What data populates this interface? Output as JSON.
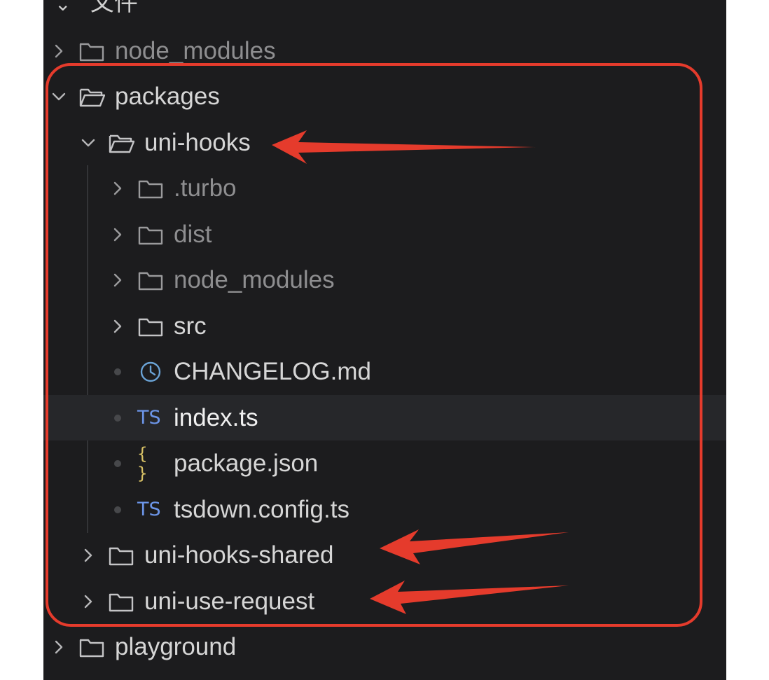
{
  "explorer": {
    "header_label": "文件",
    "items": [
      {
        "label": "node_modules"
      },
      {
        "label": "packages"
      },
      {
        "label": "uni-hooks"
      },
      {
        "label": ".turbo"
      },
      {
        "label": "dist"
      },
      {
        "label": "node_modules"
      },
      {
        "label": "src"
      },
      {
        "label": "CHANGELOG.md"
      },
      {
        "label": "index.ts",
        "icon_text": "TS"
      },
      {
        "label": "package.json",
        "icon_text": "{ }"
      },
      {
        "label": "tsdown.config.ts",
        "icon_text": "TS"
      },
      {
        "label": "uni-hooks-shared"
      },
      {
        "label": "uni-use-request"
      },
      {
        "label": "playground"
      }
    ]
  },
  "colors": {
    "panel_bg": "#1c1c1e",
    "text": "#d6d6d6",
    "ignored_text": "#8e8e90",
    "selection_row": "#26272a",
    "annotation_red": "#e53b2c",
    "ts_icon": "#6c95e8",
    "json_icon": "#d9c266",
    "changelog_icon": "#6aa3d6"
  }
}
